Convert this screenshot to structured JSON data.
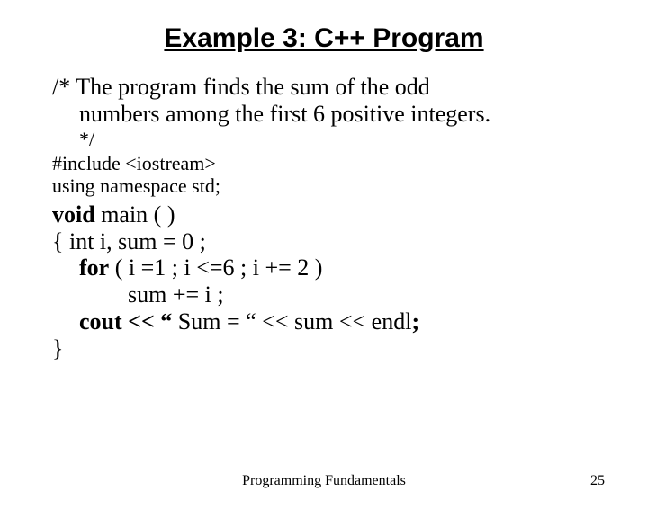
{
  "title": "Example 3: C++ Program",
  "comment_prefix": "/* The program ",
  "comment_bold1": "finds the sum of the odd",
  "comment_bold2": "numbers among the first 6 positive integers.",
  "comment_close": "*/",
  "include_line": "#include <iostream>",
  "using_line": "using namespace std;",
  "void_kw": "void",
  "main_sig": " main ( )",
  "brace_open": "{ ",
  "decl_rest": "int i, sum = 0 ;",
  "for_kw": "for",
  "for_rest": " ( i =1 ; i <=6 ; i += 2 )",
  "sum_line": "sum += i ;",
  "cout_kw": "cout << “ ",
  "cout_mid": "Sum =  “ << sum << endl",
  "cout_end": ";",
  "brace_close": "}",
  "footer_center": "Programming Fundamentals",
  "footer_right": "25"
}
